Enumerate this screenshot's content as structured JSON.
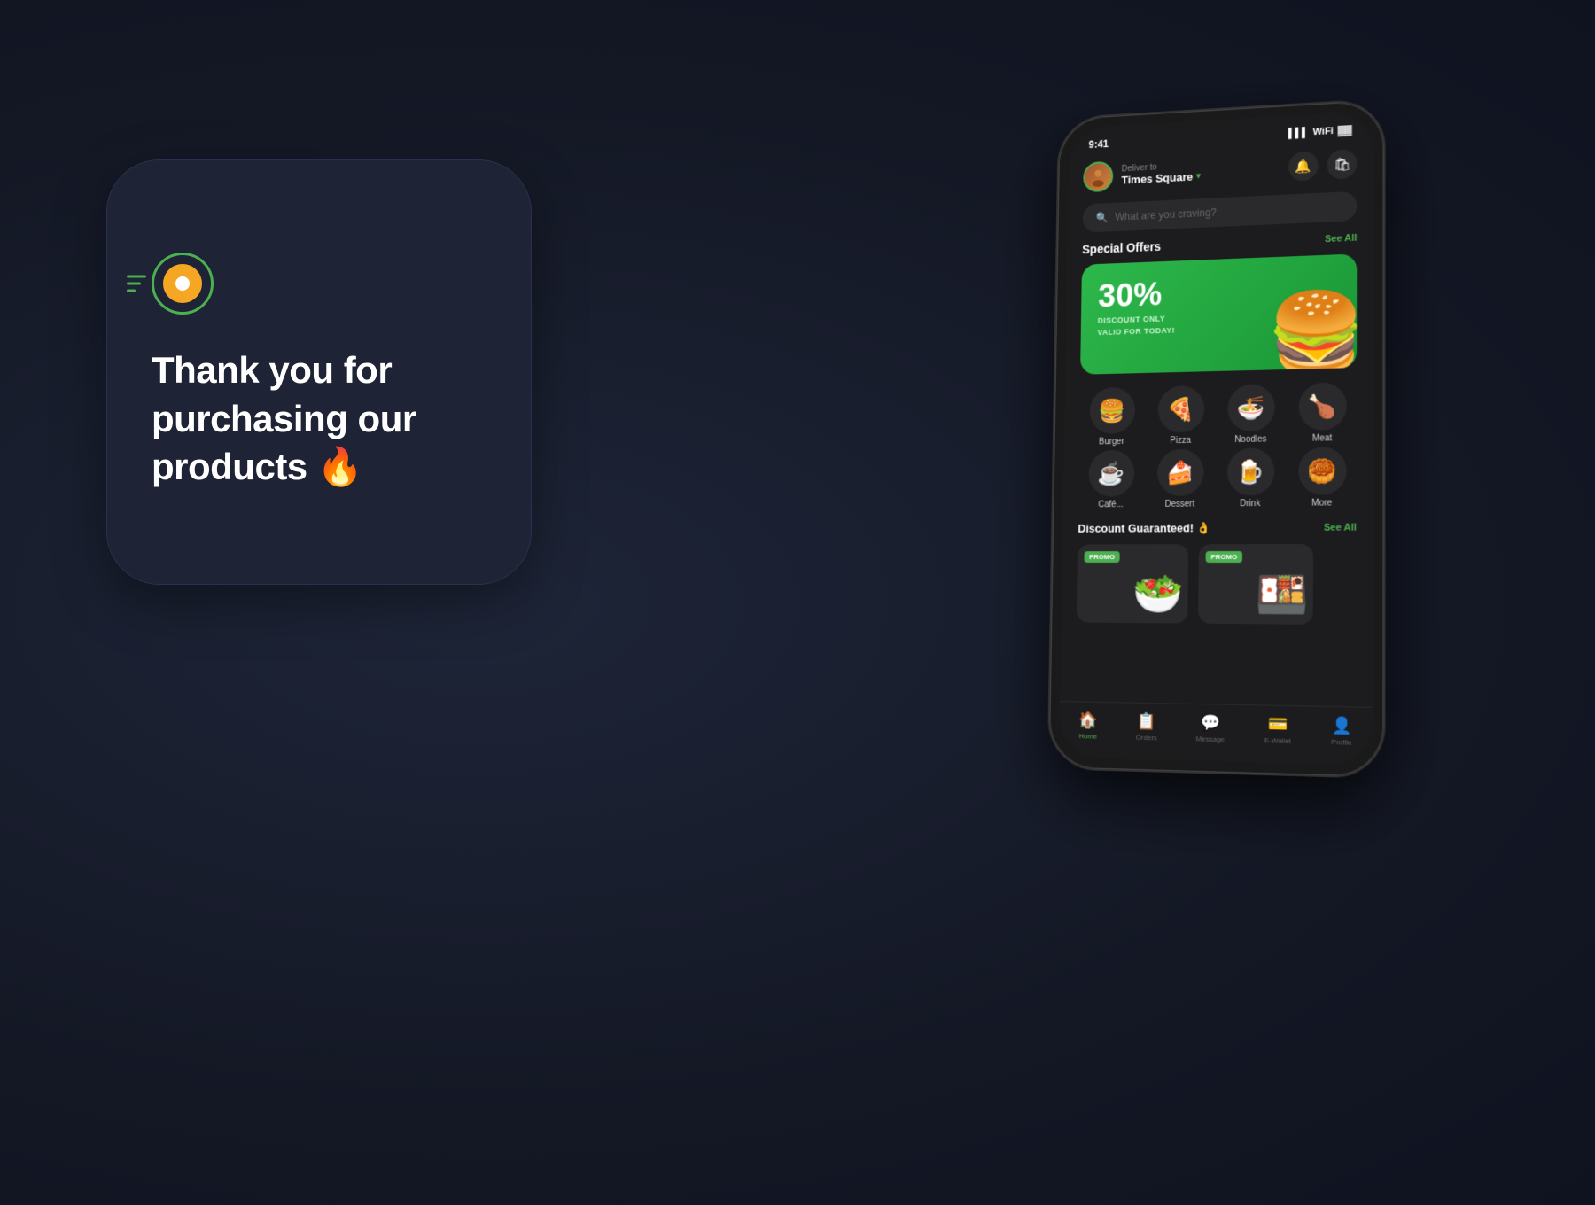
{
  "background": {
    "color": "#1a1f2e"
  },
  "card": {
    "logo_lines": [
      16,
      12,
      8
    ],
    "thank_you_text": "Thank you for purchasing our products 🔥"
  },
  "phone": {
    "status_bar": {
      "time": "9:41",
      "signal": "▌▌▌",
      "wifi": "◈",
      "battery": "▓▓▓"
    },
    "header": {
      "avatar_emoji": "👤",
      "deliver_label": "Deliver to",
      "location": "Times Square",
      "dropdown": "▾",
      "bell_icon": "🔔",
      "bag_icon": "🛍"
    },
    "search": {
      "placeholder": "What are you craving?",
      "search_icon": "🔍"
    },
    "special_offers": {
      "title": "Special Offers",
      "see_all": "See All",
      "banner": {
        "discount": "30%",
        "subtitle_line1": "DISCOUNT ONLY",
        "subtitle_line2": "VALID FOR TODAY!",
        "burger_emoji": "🍔"
      }
    },
    "categories": [
      {
        "emoji": "🍔",
        "label": "Burger"
      },
      {
        "emoji": "🍕",
        "label": "Pizza"
      },
      {
        "emoji": "🍜",
        "label": "Noodles"
      },
      {
        "emoji": "🍗",
        "label": "Meat"
      },
      {
        "emoji": "☕",
        "label": "Café..."
      },
      {
        "emoji": "🍰",
        "label": "Dessert"
      },
      {
        "emoji": "🍺",
        "label": "Drink"
      },
      {
        "emoji": "🥮",
        "label": "More"
      }
    ],
    "discount_section": {
      "title": "Discount Guaranteed! 👌",
      "see_all": "See All"
    },
    "products": [
      {
        "emoji": "🥗",
        "has_promo": true
      },
      {
        "emoji": "🍱",
        "has_promo": true
      }
    ],
    "bottom_nav": [
      {
        "icon": "🏠",
        "label": "Home",
        "active": true
      },
      {
        "icon": "📋",
        "label": "Orders",
        "active": false
      },
      {
        "icon": "💬",
        "label": "Message",
        "active": false
      },
      {
        "icon": "💳",
        "label": "E-Wallet",
        "active": false
      },
      {
        "icon": "👤",
        "label": "Profile",
        "active": false
      }
    ]
  },
  "colors": {
    "accent_green": "#4caf50",
    "background_dark": "#1a1f2e",
    "card_background": "#1e2335",
    "phone_background": "#1c1c1e",
    "promo_green": "#2db84b"
  },
  "labels": {
    "promo": "PROMO"
  }
}
